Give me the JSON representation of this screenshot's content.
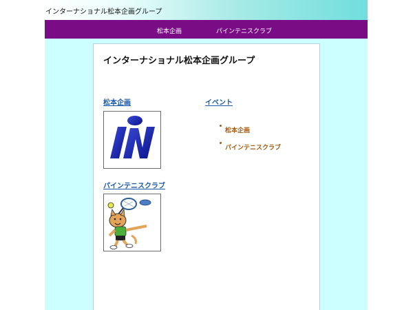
{
  "header": {
    "title": "インターナショナル松本企画グループ"
  },
  "nav": {
    "items": [
      {
        "label": "松本企画"
      },
      {
        "label": "パインテニスクラブ"
      }
    ]
  },
  "main": {
    "page_title": "インターナショナル松本企画グループ",
    "sections": [
      {
        "label": "松本企画",
        "image": "company-logo"
      },
      {
        "label": "パインテニスクラブ",
        "image": "tennis-cat-mascot"
      }
    ],
    "events": {
      "label": "イベント",
      "items": [
        {
          "label": "松本企画"
        },
        {
          "label": "パインテニスクラブ"
        }
      ]
    }
  },
  "colors": {
    "nav_bg": "#7a0d86",
    "page_bg": "#ccffff",
    "link": "#1c5aa6",
    "event_link": "#a05a10"
  }
}
